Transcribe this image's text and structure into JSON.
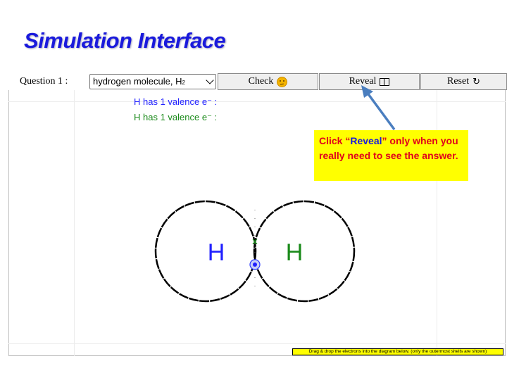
{
  "title": "Simulation Interface",
  "toolbar": {
    "question_label": "Question 1 :",
    "select_value": "hydrogen molecule, H",
    "select_subscript": "2",
    "check_label": "Check",
    "reveal_label": "Reveal",
    "reset_label": "Reset",
    "reset_glyph": "↻"
  },
  "valence": {
    "line1": "H has 1 valence e⁻ :",
    "line2": "H has 1 valence e⁻ :"
  },
  "callout": {
    "prefix": "Click “",
    "keyword": "Reveal",
    "suffix": "” only when you really need to see the answer."
  },
  "diagram": {
    "atom_left": "H",
    "atom_right": "H",
    "cross_marker": "x"
  },
  "instruction": "Drag & drop the electrons into the diagram below. (only the outermost shells are shown)",
  "colors": {
    "title": "#1a1adc",
    "atom_left": "#2020ff",
    "atom_right": "#1a8a1a",
    "callout_bg": "#ffff00",
    "callout_text": "#e0001b",
    "arrow": "#4a7ebf"
  }
}
